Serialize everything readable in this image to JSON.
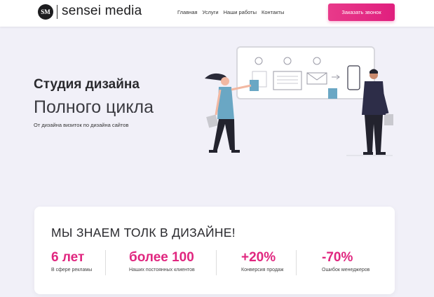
{
  "header": {
    "logo_badge": "SM",
    "logo_text": "sensei media",
    "nav": [
      "Главная",
      "Услуги",
      "Наши работы",
      "Контакты"
    ],
    "cta_label": "Заказать звонок"
  },
  "hero": {
    "title": "Студия дизайна",
    "subtitle": "Полного цикла",
    "caption": "От дизайна визиток по дизайна сайтов"
  },
  "stats_card": {
    "title": "МЫ ЗНАЕМ ТОЛК В ДИЗАЙНЕ!",
    "stats": [
      {
        "value": "6 лет",
        "label": "В сфере рекламы"
      },
      {
        "value": "более 100",
        "label": "Наших постоянных клиентов"
      },
      {
        "value": "+20%",
        "label": "Конверсия продаж"
      },
      {
        "value": "-70%",
        "label": "Ошибок менеджеров"
      }
    ]
  },
  "colors": {
    "accent": "#e0267f",
    "background": "#f1f0f8",
    "card": "#ffffff",
    "logo": "#1d1d1f"
  }
}
